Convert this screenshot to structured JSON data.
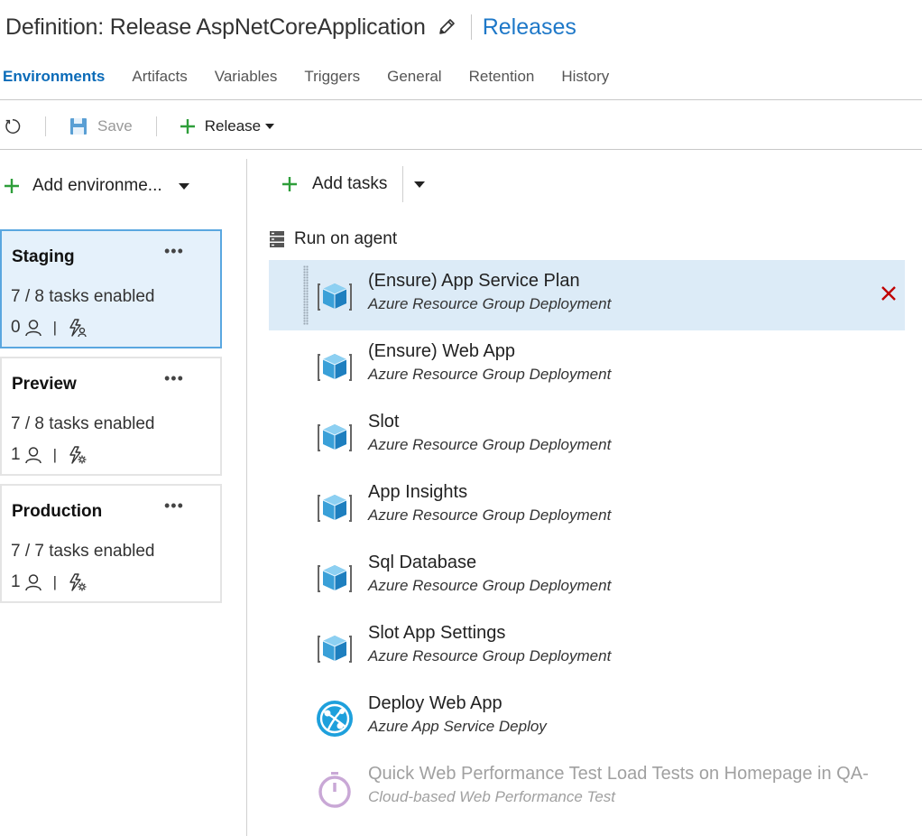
{
  "header": {
    "title": "Definition: Release AspNetCoreApplication",
    "releases_link": "Releases"
  },
  "tabs": [
    {
      "label": "Environments",
      "active": true
    },
    {
      "label": "Artifacts"
    },
    {
      "label": "Variables"
    },
    {
      "label": "Triggers"
    },
    {
      "label": "General"
    },
    {
      "label": "Retention"
    },
    {
      "label": "History"
    }
  ],
  "toolbar": {
    "save_label": "Save",
    "release_label": "Release"
  },
  "environments": {
    "add_label": "Add environme...",
    "more_glyph": "•••",
    "items": [
      {
        "name": "Staging",
        "tasks": "7 / 8 tasks enabled",
        "approvers": "0",
        "selected": true
      },
      {
        "name": "Preview",
        "tasks": "7 / 8 tasks enabled",
        "approvers": "1"
      },
      {
        "name": "Production",
        "tasks": "7 / 7 tasks enabled",
        "approvers": "1"
      }
    ]
  },
  "tasks_panel": {
    "add_label": "Add tasks",
    "phase_label": "Run on agent",
    "tasks": [
      {
        "name": "(Ensure) App Service Plan",
        "type": "Azure Resource Group Deployment",
        "icon": "azure-resource-group-icon",
        "selected": true
      },
      {
        "name": "(Ensure) Web App",
        "type": "Azure Resource Group Deployment",
        "icon": "azure-resource-group-icon"
      },
      {
        "name": "Slot",
        "type": "Azure Resource Group Deployment",
        "icon": "azure-resource-group-icon"
      },
      {
        "name": "App Insights",
        "type": "Azure Resource Group Deployment",
        "icon": "azure-resource-group-icon"
      },
      {
        "name": "Sql Database",
        "type": "Azure Resource Group Deployment",
        "icon": "azure-resource-group-icon"
      },
      {
        "name": "Slot App Settings",
        "type": "Azure Resource Group Deployment",
        "icon": "azure-resource-group-icon"
      },
      {
        "name": "Deploy Web App",
        "type": "Azure App Service Deploy",
        "icon": "app-service-globe-icon"
      },
      {
        "name": "Quick Web Performance Test Load Tests on Homepage in QA-",
        "type": "Cloud-based Web Performance Test",
        "icon": "stopwatch-icon",
        "disabled": true
      }
    ]
  },
  "colors": {
    "accent": "#0a6bb8",
    "link": "#1e78c8",
    "selected_bg": "#dcebf7",
    "selected_env_bg": "#e5f1fb",
    "selected_env_border": "#5aa7e0",
    "plus_green": "#2e9e3a",
    "delete_red": "#c00000"
  }
}
